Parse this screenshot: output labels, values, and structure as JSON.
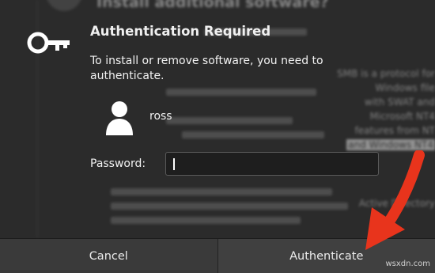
{
  "background": {
    "title": "Install additional software?",
    "subtitle": "a a a a a a a",
    "right_lines": [
      "SMB is a protocol for",
      "Windows file",
      "with SWAT and",
      "Microsoft NT4",
      "features from NT",
      "and Windows NT4",
      "Active Directory"
    ]
  },
  "dialog": {
    "title": "Authentication Required",
    "message": "To install or remove software, you need to authenticate.",
    "username": "ross",
    "password_label": "Password:",
    "password_value": ""
  },
  "buttons": {
    "cancel_label": "Cancel",
    "authenticate_label": "Authenticate"
  },
  "annotation": {
    "arrow_color": "#e8341c"
  },
  "watermark": "wsxdn.com",
  "icons": {
    "key": "key-icon",
    "user": "user-avatar-icon",
    "arrow": "annotation-arrow"
  }
}
